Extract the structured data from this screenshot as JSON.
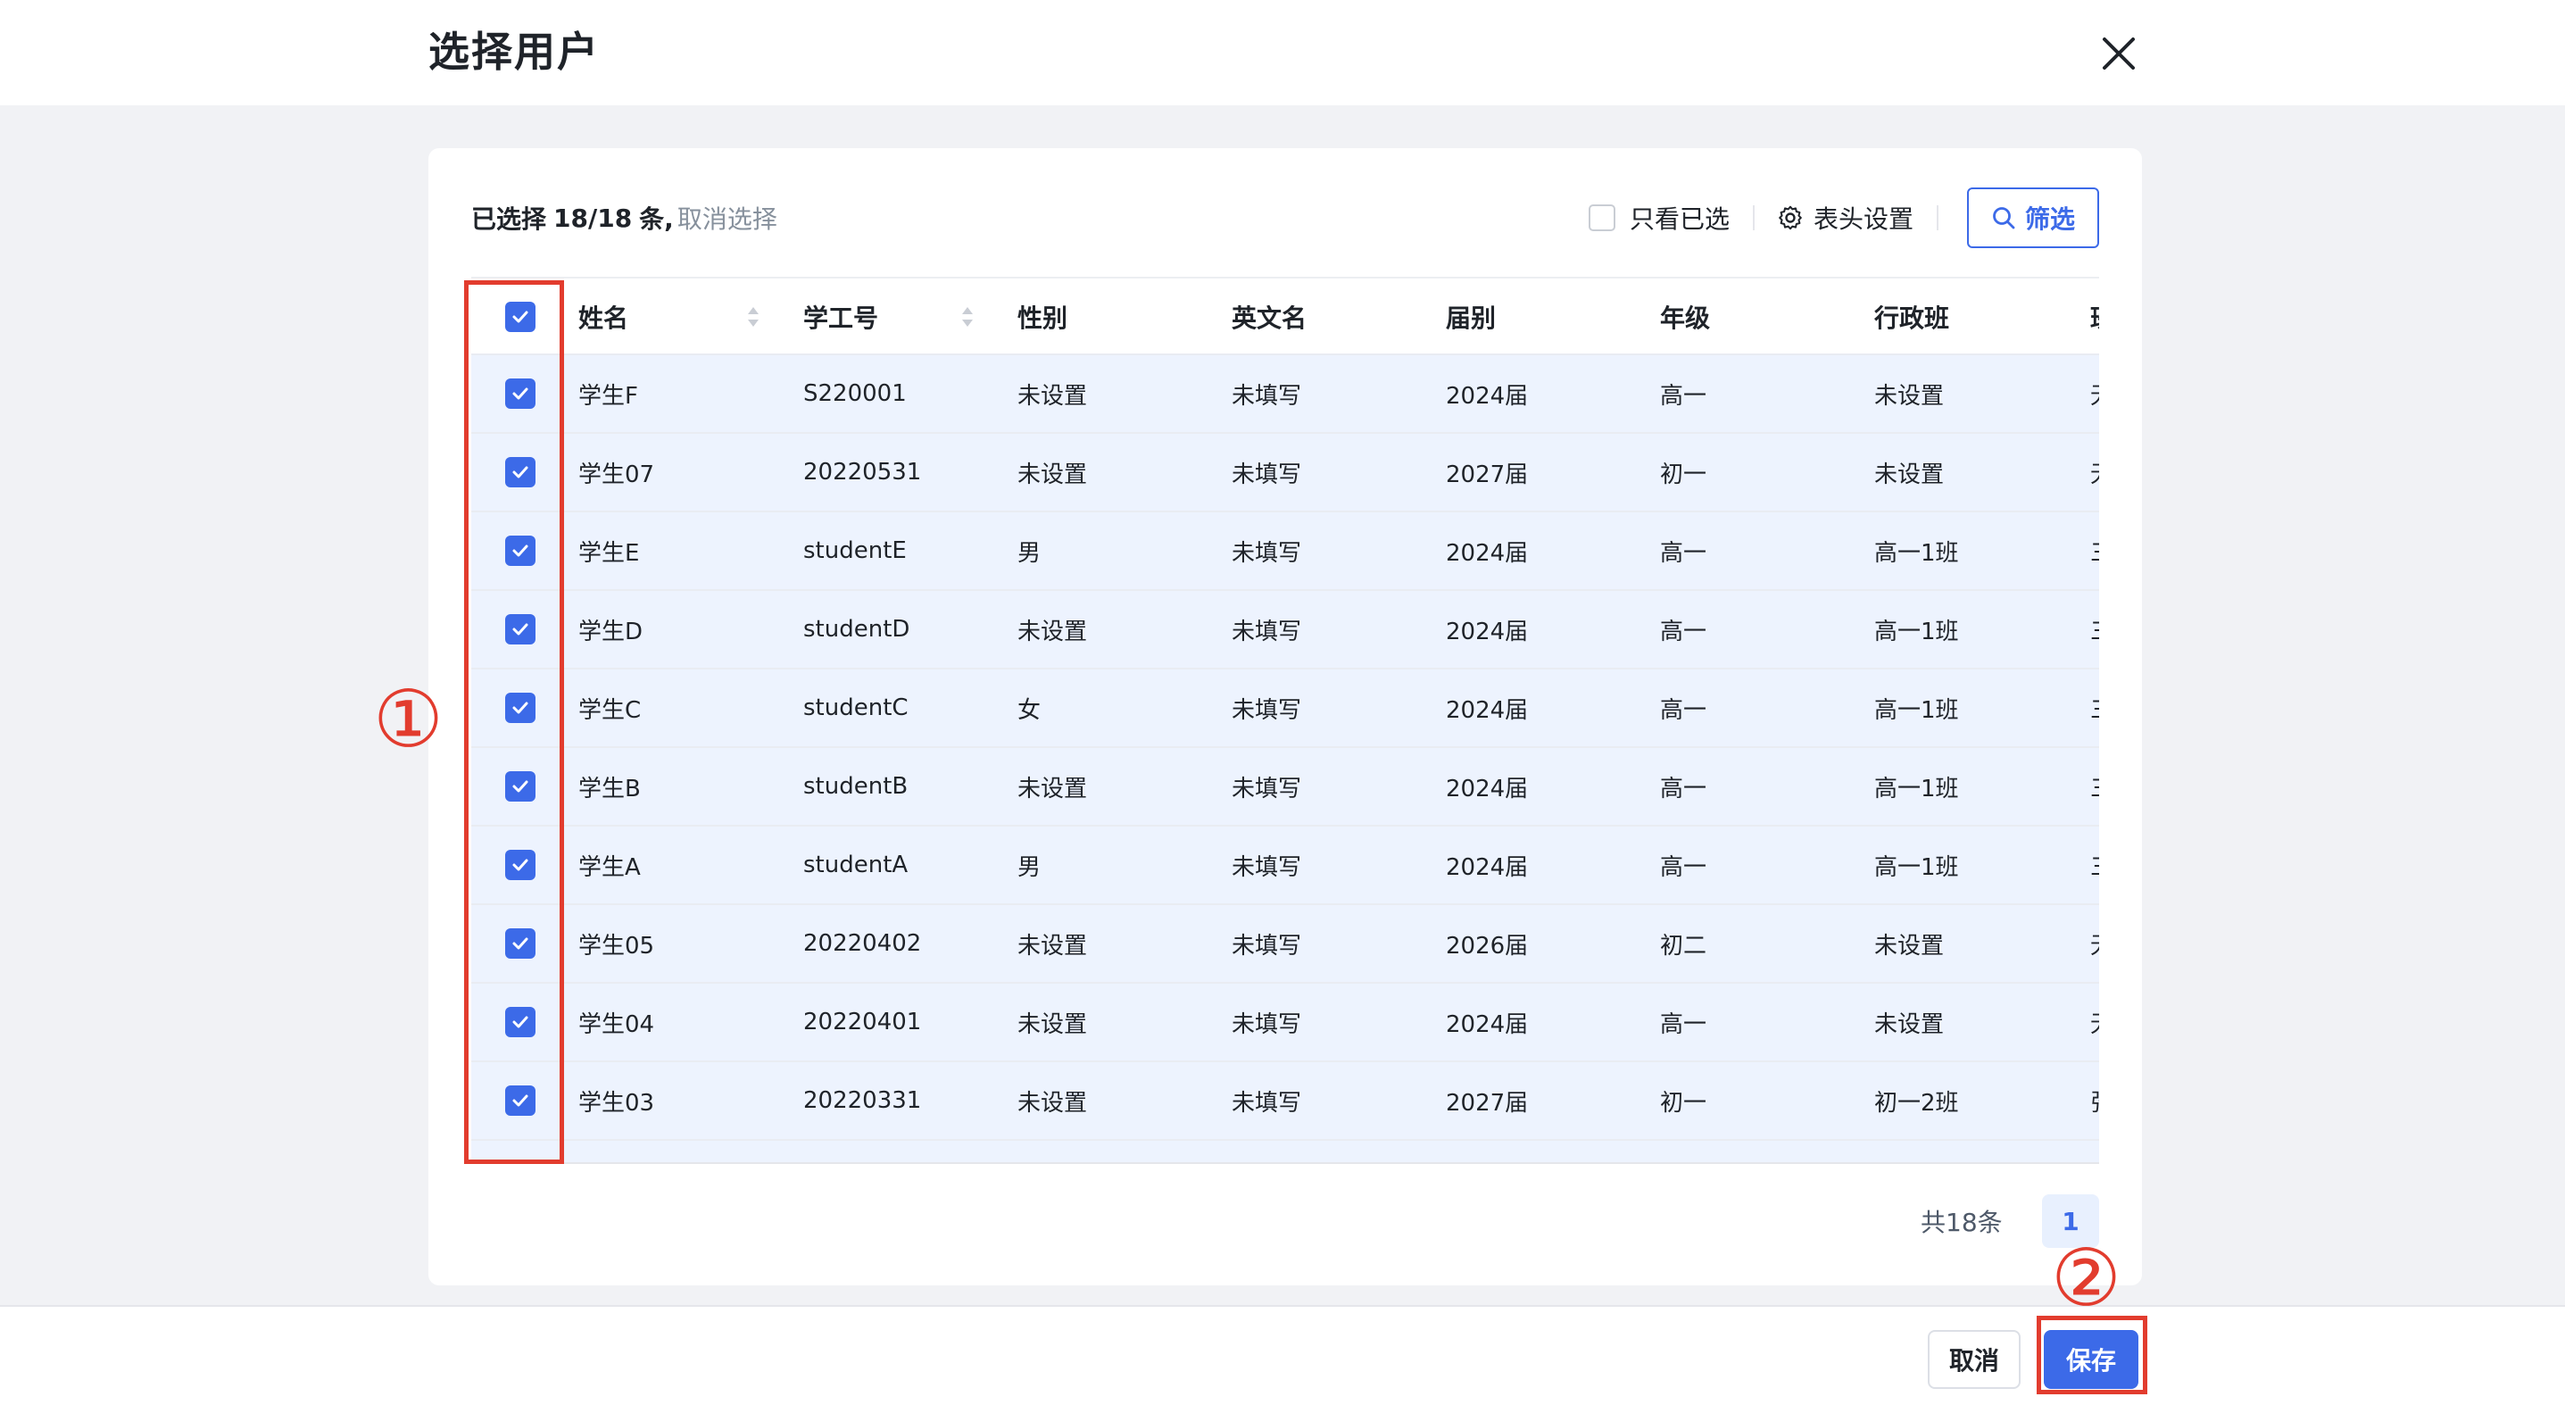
{
  "header": {
    "title": "选择用户"
  },
  "toolbar": {
    "selected_prefix": "已选择",
    "selected_count": "18/18",
    "selected_suffix": "条,",
    "clear_selection": "取消选择",
    "only_selected": "只看已选",
    "column_settings": "表头设置",
    "filter": "筛选"
  },
  "table": {
    "headers": [
      "姓名",
      "学工号",
      "性别",
      "英文名",
      "届别",
      "年级",
      "行政班",
      "班"
    ],
    "rows": [
      [
        "学生F",
        "S220001",
        "未设置",
        "未填写",
        "2024届",
        "高一",
        "未设置",
        "无"
      ],
      [
        "学生07",
        "20220531",
        "未设置",
        "未填写",
        "2027届",
        "初一",
        "未设置",
        "无"
      ],
      [
        "学生E",
        "studentE",
        "男",
        "未填写",
        "2024届",
        "高一",
        "高一1班",
        "三"
      ],
      [
        "学生D",
        "studentD",
        "未设置",
        "未填写",
        "2024届",
        "高一",
        "高一1班",
        "三"
      ],
      [
        "学生C",
        "studentC",
        "女",
        "未填写",
        "2024届",
        "高一",
        "高一1班",
        "三"
      ],
      [
        "学生B",
        "studentB",
        "未设置",
        "未填写",
        "2024届",
        "高一",
        "高一1班",
        "三"
      ],
      [
        "学生A",
        "studentA",
        "男",
        "未填写",
        "2024届",
        "高一",
        "高一1班",
        "三"
      ],
      [
        "学生05",
        "20220402",
        "未设置",
        "未填写",
        "2026届",
        "初二",
        "未设置",
        "无"
      ],
      [
        "学生04",
        "20220401",
        "未设置",
        "未填写",
        "2024届",
        "高一",
        "未设置",
        "无"
      ],
      [
        "学生03",
        "20220331",
        "未设置",
        "未填写",
        "2027届",
        "初一",
        "初一2班",
        "张"
      ]
    ]
  },
  "pagination": {
    "total": "共18条",
    "current": "1"
  },
  "footer": {
    "cancel": "取消",
    "save": "保存"
  },
  "annotations": {
    "one": "①",
    "two": "②"
  },
  "colors": {
    "accent": "#3c6ae8",
    "annotation": "#e23c2e",
    "row_bg": "#edf3fe"
  },
  "icons": {
    "close": "close-icon",
    "gear": "gear-icon",
    "search": "search-icon",
    "sort": "sort-icon",
    "check": "checkmark-icon"
  }
}
